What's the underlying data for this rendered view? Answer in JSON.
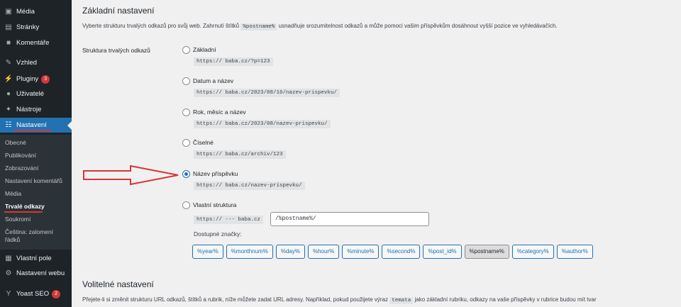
{
  "sidebar": {
    "items": [
      {
        "label": "Média",
        "icon": "media-icon",
        "glyph": "▣"
      },
      {
        "label": "Stránky",
        "icon": "pages-icon",
        "glyph": "▤"
      },
      {
        "label": "Komentáře",
        "icon": "comments-icon",
        "glyph": "■"
      },
      {
        "label": "Vzhled",
        "icon": "appearance-icon",
        "glyph": "✎"
      },
      {
        "label": "Pluginy",
        "icon": "plugins-icon",
        "glyph": "⚡",
        "badge": "3"
      },
      {
        "label": "Uživatelé",
        "icon": "users-icon",
        "glyph": "●"
      },
      {
        "label": "Nástroje",
        "icon": "tools-icon",
        "glyph": "✦"
      },
      {
        "label": "Nastavení",
        "icon": "settings-icon",
        "glyph": "☷"
      }
    ],
    "submenu": [
      "Obecné",
      "Publikování",
      "Zobrazování",
      "Nastavení komentářů",
      "Média",
      "Trvalé odkazy",
      "Soukromí",
      "Čeština: zalomení řádků"
    ],
    "bottom_items": [
      {
        "label": "Vlastní pole",
        "icon": "custom-fields-icon",
        "glyph": "▦"
      },
      {
        "label": "Nastavení webu",
        "icon": "site-settings-icon",
        "glyph": "⚙"
      },
      {
        "label": "Yoast SEO",
        "icon": "yoast-icon",
        "glyph": "Y",
        "badge": "2"
      }
    ],
    "accent_color": "#2271b1",
    "highlight_color": "#d63638"
  },
  "main": {
    "section1_title": "Základní nastavení",
    "section1_desc_pre": "Vyberte strukturu trvalých odkazů pro svůj web. Zahrnutí štítků",
    "section1_desc_code": "%postname%",
    "section1_desc_post": "usnadňuje srozumitelnost odkazů a může pomoci vašim příspěvkům dosáhnout vyšší pozice ve vyhledávačích.",
    "row_label": "Struktura trvalých odkazů",
    "options": [
      {
        "label": "Základní",
        "example": "https://      baba.cz/?p=123",
        "checked": false
      },
      {
        "label": "Datum a název",
        "example": "https://      baba.cz/2023/08/16/nazev-prispevku/",
        "checked": false
      },
      {
        "label": "Rok, měsíc a název",
        "example": "https://      baba.cz/2023/08/nazev-prispevku/",
        "checked": false
      },
      {
        "label": "Číselné",
        "example": "https://      baba.cz/archiv/123",
        "checked": false
      },
      {
        "label": "Název příspěvku",
        "example": "https://      baba.cz/nazev-prispevku/",
        "checked": true
      },
      {
        "label": "Vlastní struktura",
        "example": "https://  ---  baba.cz",
        "checked": false
      }
    ],
    "custom_value": "/%postname%/",
    "available_tags_label": "Dostupné značky:",
    "tags": [
      "%year%",
      "%monthnum%",
      "%day%",
      "%hour%",
      "%minute%",
      "%second%",
      "%post_id%",
      "%postname%",
      "%category%",
      "%author%"
    ],
    "pressed_tag": "%postname%",
    "section2_title": "Volitelné nastavení",
    "section2_desc_pre": "Přejete-li si změnit strukturu URL odkazů, štítků a rubrik, níže můžete zadat URL adresy. Například, pokud použijete výraz",
    "section2_desc_code": "temata",
    "section2_desc_post": "jako základní rubriku, odkazy na vaše příspěvky v rubrice budou mít tvar"
  }
}
